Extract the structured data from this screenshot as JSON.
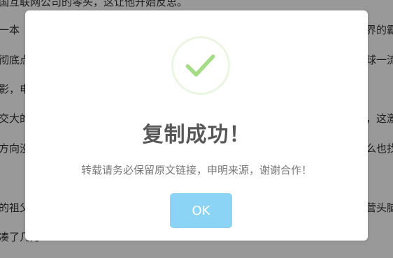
{
  "article": {
    "lines": [
      {
        "text": "国互联网公司的零头，这让他开始反思。",
        "side": "left"
      },
      {
        "text": "一本《硅",
        "side": "left"
      },
      {
        "text": "界的霸",
        "side": "right"
      },
      {
        "text": "彻底点燃",
        "side": "left"
      },
      {
        "text": "球一流",
        "side": "right"
      },
      {
        "text": "影，电",
        "side": "left"
      },
      {
        "text": "交大的硅",
        "side": "left"
      },
      {
        "text": "，这激",
        "side": "right"
      },
      {
        "text": "方向没找",
        "side": "left"
      },
      {
        "text": "么也找",
        "side": "right"
      },
      {
        "text": "的祖父曾",
        "side": "left"
      },
      {
        "text": "营头脑",
        "side": "right"
      },
      {
        "text": "凑了几万",
        "side": "left"
      }
    ]
  },
  "modal": {
    "icon": "success-checkmark",
    "title": "复制成功！",
    "message": "转载请务必保留原文链接，申明来源，谢谢合作！",
    "button_label": "OK"
  },
  "colors": {
    "overlay": "rgba(0,0,0,0.40)",
    "check": "#a5dc86",
    "check_ring": "#eaf5e2",
    "button": "#8cd4f5"
  }
}
